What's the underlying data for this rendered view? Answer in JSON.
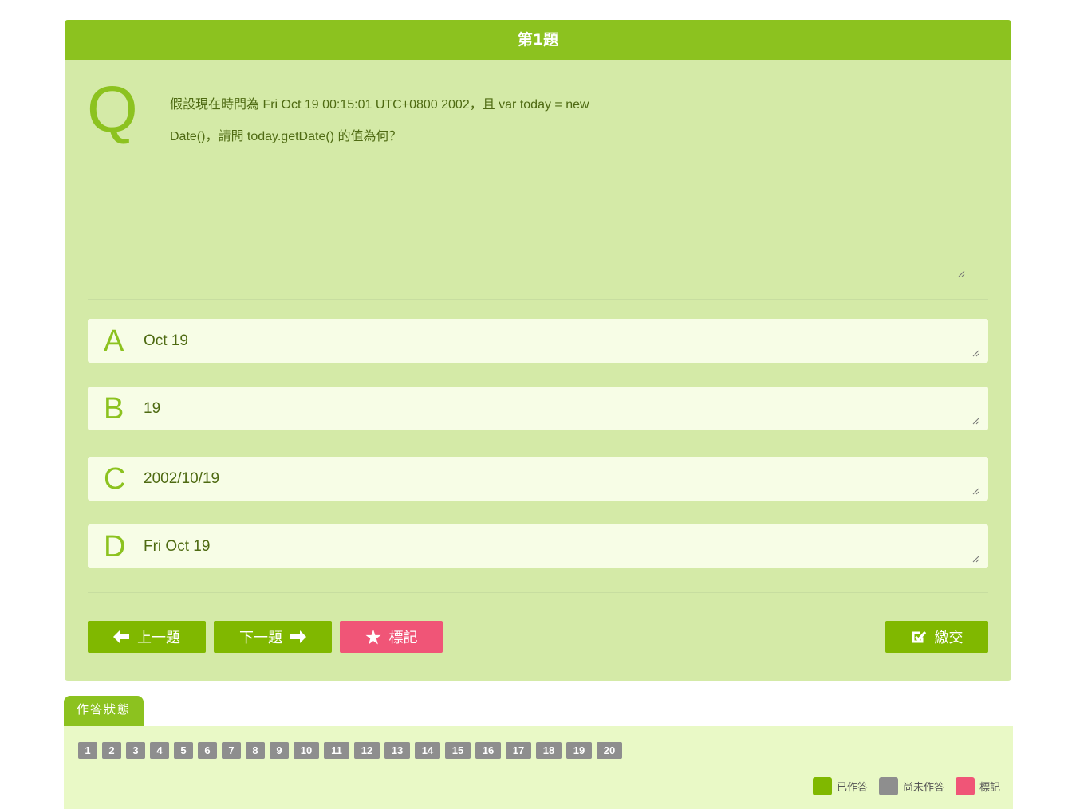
{
  "question": {
    "header": "第1題",
    "q_letter": "Q",
    "text": "假設現在時間為 Fri Oct 19 00:15:01 UTC+0800 2002，且 var today = new Date()，請問 today.getDate() 的值為何？"
  },
  "options": [
    {
      "letter": "A",
      "text": "Oct 19"
    },
    {
      "letter": "B",
      "text": "19"
    },
    {
      "letter": "C",
      "text": "2002/10/19"
    },
    {
      "letter": "D",
      "text": "Fri Oct 19"
    }
  ],
  "buttons": {
    "prev": "上一題",
    "next": "下一題",
    "mark": "標記",
    "submit": "繳交"
  },
  "status": {
    "tab_label": "作答狀態",
    "numbers": [
      "1",
      "2",
      "3",
      "4",
      "5",
      "6",
      "7",
      "8",
      "9",
      "10",
      "11",
      "12",
      "13",
      "14",
      "15",
      "16",
      "17",
      "18",
      "19",
      "20"
    ],
    "legend": {
      "answered": "已作答",
      "unanswered": "尚未作答",
      "marked": "標記"
    }
  },
  "colors": {
    "header": "#8cc21f",
    "card": "#d4eaa7",
    "answered": "#80b800",
    "unanswered": "#8e8e8e",
    "marked": "#f05577"
  }
}
